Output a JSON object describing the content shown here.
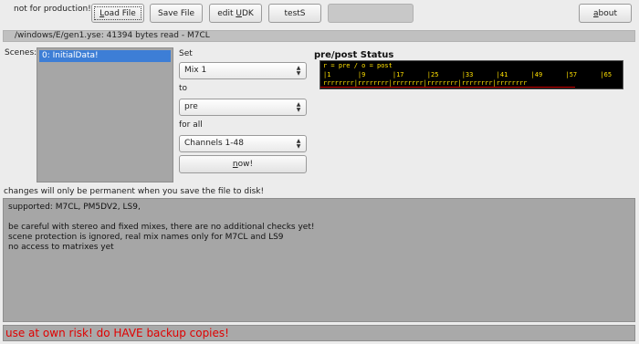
{
  "header": {
    "note": "not for production!",
    "load_file_prefix": "L",
    "load_file_rest": "oad File",
    "save_file": "Save File",
    "edit_prefix": "edit ",
    "edit_u": "U",
    "edit_rest": "DK",
    "test": "testS",
    "about_prefix": "a",
    "about_rest": "bout"
  },
  "path": "/windows/E/gen1.yse: 41394 bytes read - M7CL",
  "scenes": {
    "label": "Scenes:",
    "items": [
      "0: InitialData!"
    ]
  },
  "set": {
    "set_label": "Set",
    "mix_value": "Mix 1",
    "to_label": "to",
    "to_value": "pre",
    "forall_label": "for all",
    "channels_value": "Channels 1-48",
    "now_u": "n",
    "now_rest": "ow!"
  },
  "status": {
    "title": "pre/post Status",
    "legend": "r = pre / o = post",
    "ticks": "|1       |9       |17      |25      |33      |41      |49      |57      |65",
    "states": "rrrrrrrr|rrrrrrrr|rrrrrrrr|rrrrrrrr|rrrrrrrr|rrrrrrrr"
  },
  "notice": "changes will only be permanent when you save the file to disk!",
  "info_lines": [
    "supported: M7CL, PM5DV2, LS9,",
    "",
    "be careful with stereo and fixed mixes, there are no additional checks yet!",
    "scene protection is ignored, real mix names only for M7CL and LS9",
    "no access to matrixes yet"
  ],
  "warning": "use at own risk! do HAVE backup copies!"
}
